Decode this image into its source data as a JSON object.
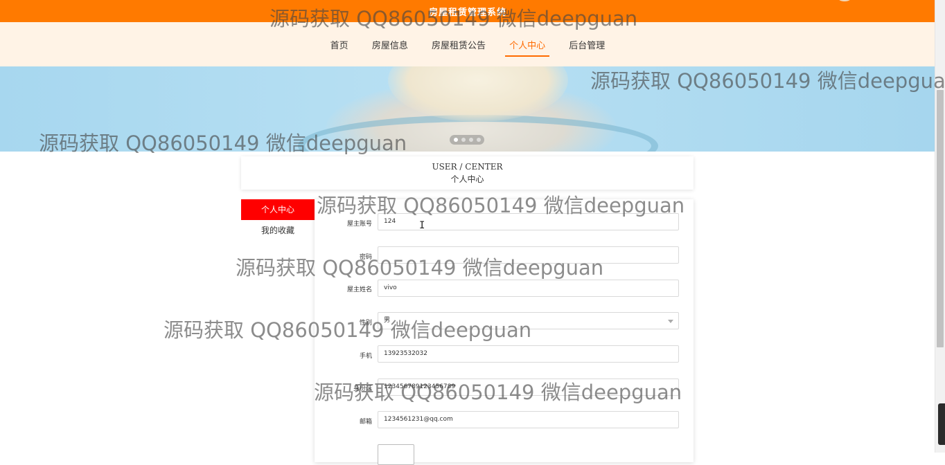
{
  "topbar": {
    "title": "房屋租赁管理系统"
  },
  "nav": {
    "items": [
      {
        "label": "首页",
        "active": false
      },
      {
        "label": "房屋信息",
        "active": false
      },
      {
        "label": "房屋租赁公告",
        "active": false
      },
      {
        "label": "个人中心",
        "active": true
      },
      {
        "label": "后台管理",
        "active": false
      }
    ]
  },
  "banner": {
    "slides": 4,
    "active_slide": 1
  },
  "header": {
    "en": "USER / CENTER",
    "cn": "个人中心"
  },
  "sidebar": {
    "items": [
      {
        "label": "个人中心",
        "active": true
      },
      {
        "label": "我的收藏",
        "active": false
      }
    ]
  },
  "form": {
    "account": {
      "label": "屋主账号",
      "value": "124"
    },
    "password": {
      "label": "密码",
      "value": ""
    },
    "name": {
      "label": "屋主姓名",
      "value": "vivo"
    },
    "gender": {
      "label": "性别",
      "value": "男"
    },
    "phone": {
      "label": "手机",
      "value": "13923532032"
    },
    "idcard": {
      "label": "身份证",
      "value": "123456789123456789"
    },
    "email": {
      "label": "邮箱",
      "value": "1234561231@qq.com"
    }
  },
  "watermark": "源码获取 QQ86050149 微信deepguan",
  "colors": {
    "brand": "#ff7a00",
    "nav_bg": "#fff3e6",
    "active_nav": "#ff6a00",
    "sidebar_active": "#ff0000"
  }
}
